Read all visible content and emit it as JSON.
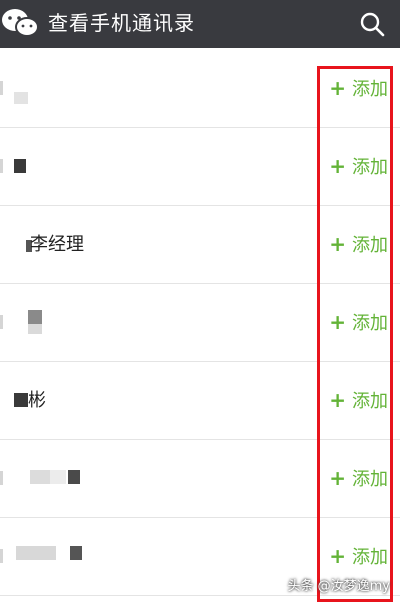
{
  "header": {
    "title": "查看手机通讯录",
    "logo_icon": "wechat-logo-icon",
    "search_icon": "search-icon",
    "background": "#393a3f"
  },
  "contacts": [
    {
      "name": "",
      "add_label": "添加"
    },
    {
      "name": "",
      "add_label": "添加"
    },
    {
      "name": "李经理",
      "add_label": "添加"
    },
    {
      "name": "",
      "add_label": "添加"
    },
    {
      "name": "彬",
      "add_label": "添加"
    },
    {
      "name": "",
      "add_label": "添加"
    },
    {
      "name": "",
      "add_label": "添加"
    }
  ],
  "accent_green": "#63b337",
  "highlight_color": "#e8141c",
  "watermark": "头条 @汝梦逸my"
}
